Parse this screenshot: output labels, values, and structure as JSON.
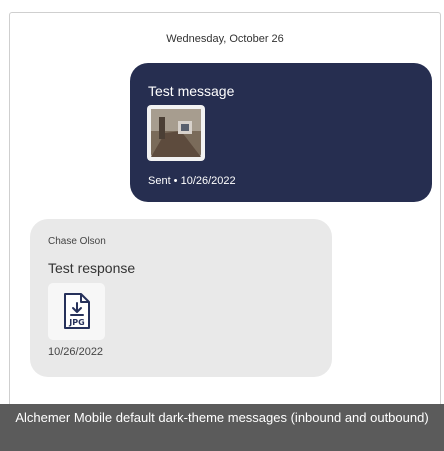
{
  "date_header": "Wednesday, October 26",
  "outbound": {
    "text": "Test message",
    "attachment_icon": "photo-thumbnail",
    "status": "Sent • 10/26/2022"
  },
  "inbound": {
    "sender": "Chase Olson",
    "text": "Test response",
    "attachment_icon": "jpg-file-icon",
    "attachment_type": "JPG",
    "timestamp": "10/26/2022"
  },
  "caption": "Alchemer Mobile default dark-theme messages (inbound and outbound)",
  "colors": {
    "outbound_bubble": "#262e50",
    "inbound_bubble": "#e9e9e9",
    "caption_bar": "#5b5b5b"
  }
}
